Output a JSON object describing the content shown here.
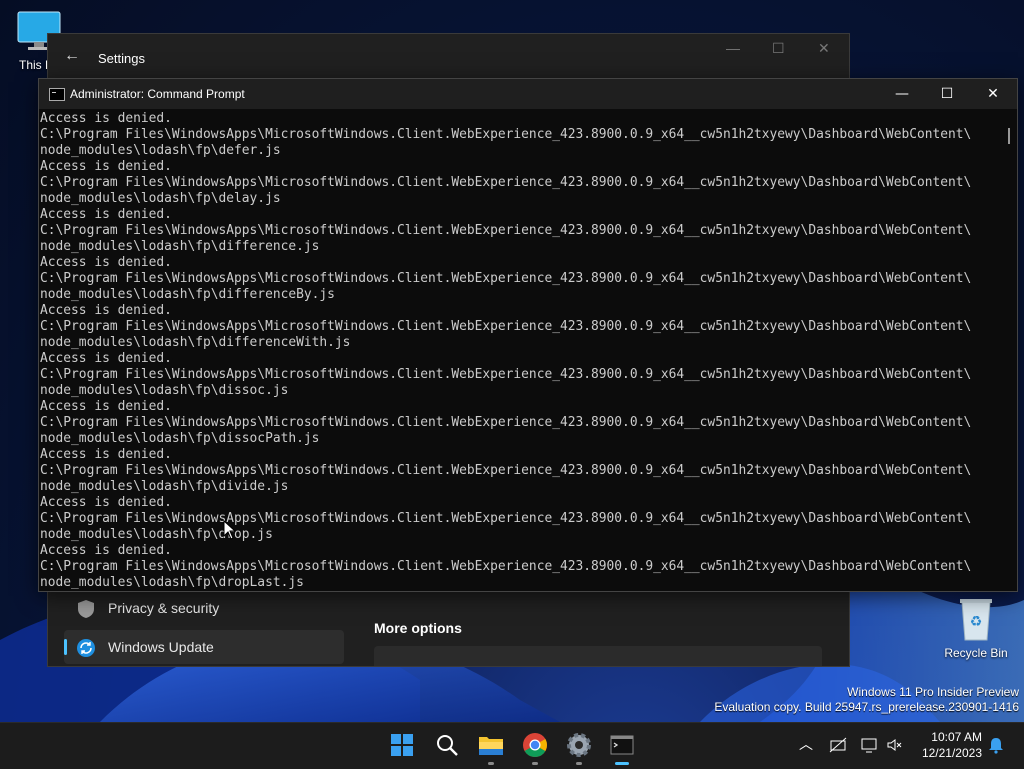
{
  "desktop": {
    "icons": [
      {
        "label": "This P"
      },
      {
        "label": "Recycle Bin"
      }
    ]
  },
  "settings_window": {
    "title": "Settings",
    "nav": [
      {
        "label": "Privacy & security",
        "icon": "shield-icon"
      },
      {
        "label": "Windows Update",
        "icon": "windows-update-icon",
        "selected": true
      }
    ],
    "section_heading": "More options"
  },
  "cmd_window": {
    "title": "Administrator: Command Prompt",
    "lines": [
      "Access is denied.",
      "C:\\Program Files\\WindowsApps\\MicrosoftWindows.Client.WebExperience_423.8900.0.9_x64__cw5n1h2txyewy\\Dashboard\\WebContent\\",
      "node_modules\\lodash\\fp\\defer.js",
      "Access is denied.",
      "C:\\Program Files\\WindowsApps\\MicrosoftWindows.Client.WebExperience_423.8900.0.9_x64__cw5n1h2txyewy\\Dashboard\\WebContent\\",
      "node_modules\\lodash\\fp\\delay.js",
      "Access is denied.",
      "C:\\Program Files\\WindowsApps\\MicrosoftWindows.Client.WebExperience_423.8900.0.9_x64__cw5n1h2txyewy\\Dashboard\\WebContent\\",
      "node_modules\\lodash\\fp\\difference.js",
      "Access is denied.",
      "C:\\Program Files\\WindowsApps\\MicrosoftWindows.Client.WebExperience_423.8900.0.9_x64__cw5n1h2txyewy\\Dashboard\\WebContent\\",
      "node_modules\\lodash\\fp\\differenceBy.js",
      "Access is denied.",
      "C:\\Program Files\\WindowsApps\\MicrosoftWindows.Client.WebExperience_423.8900.0.9_x64__cw5n1h2txyewy\\Dashboard\\WebContent\\",
      "node_modules\\lodash\\fp\\differenceWith.js",
      "Access is denied.",
      "C:\\Program Files\\WindowsApps\\MicrosoftWindows.Client.WebExperience_423.8900.0.9_x64__cw5n1h2txyewy\\Dashboard\\WebContent\\",
      "node_modules\\lodash\\fp\\dissoc.js",
      "Access is denied.",
      "C:\\Program Files\\WindowsApps\\MicrosoftWindows.Client.WebExperience_423.8900.0.9_x64__cw5n1h2txyewy\\Dashboard\\WebContent\\",
      "node_modules\\lodash\\fp\\dissocPath.js",
      "Access is denied.",
      "C:\\Program Files\\WindowsApps\\MicrosoftWindows.Client.WebExperience_423.8900.0.9_x64__cw5n1h2txyewy\\Dashboard\\WebContent\\",
      "node_modules\\lodash\\fp\\divide.js",
      "Access is denied.",
      "C:\\Program Files\\WindowsApps\\MicrosoftWindows.Client.WebExperience_423.8900.0.9_x64__cw5n1h2txyewy\\Dashboard\\WebContent\\",
      "node_modules\\lodash\\fp\\drop.js",
      "Access is denied.",
      "C:\\Program Files\\WindowsApps\\MicrosoftWindows.Client.WebExperience_423.8900.0.9_x64__cw5n1h2txyewy\\Dashboard\\WebContent\\",
      "node_modules\\lodash\\fp\\dropLast.js"
    ]
  },
  "watermark": {
    "line1": "Windows 11 Pro Insider Preview",
    "line2": "Evaluation copy. Build 25947.rs_prerelease.230901-1416"
  },
  "taskbar": {
    "apps": [
      {
        "icon": "start-icon"
      },
      {
        "icon": "search-icon"
      },
      {
        "icon": "file-explorer-icon",
        "state": "running"
      },
      {
        "icon": "chrome-icon",
        "state": "running"
      },
      {
        "icon": "settings-icon",
        "state": "running"
      },
      {
        "icon": "command-prompt-icon",
        "state": "active"
      }
    ],
    "tray_icons": [
      "chevron-up-icon",
      "network-off-icon",
      "display-icon",
      "volume-muted-icon",
      "notification-bell-icon"
    ],
    "clock": {
      "time": "10:07 AM",
      "date": "12/21/2023"
    }
  },
  "colors": {
    "accent": "#4cc2ff",
    "console_bg": "#0c0c0c",
    "console_fg": "#cccccc"
  }
}
